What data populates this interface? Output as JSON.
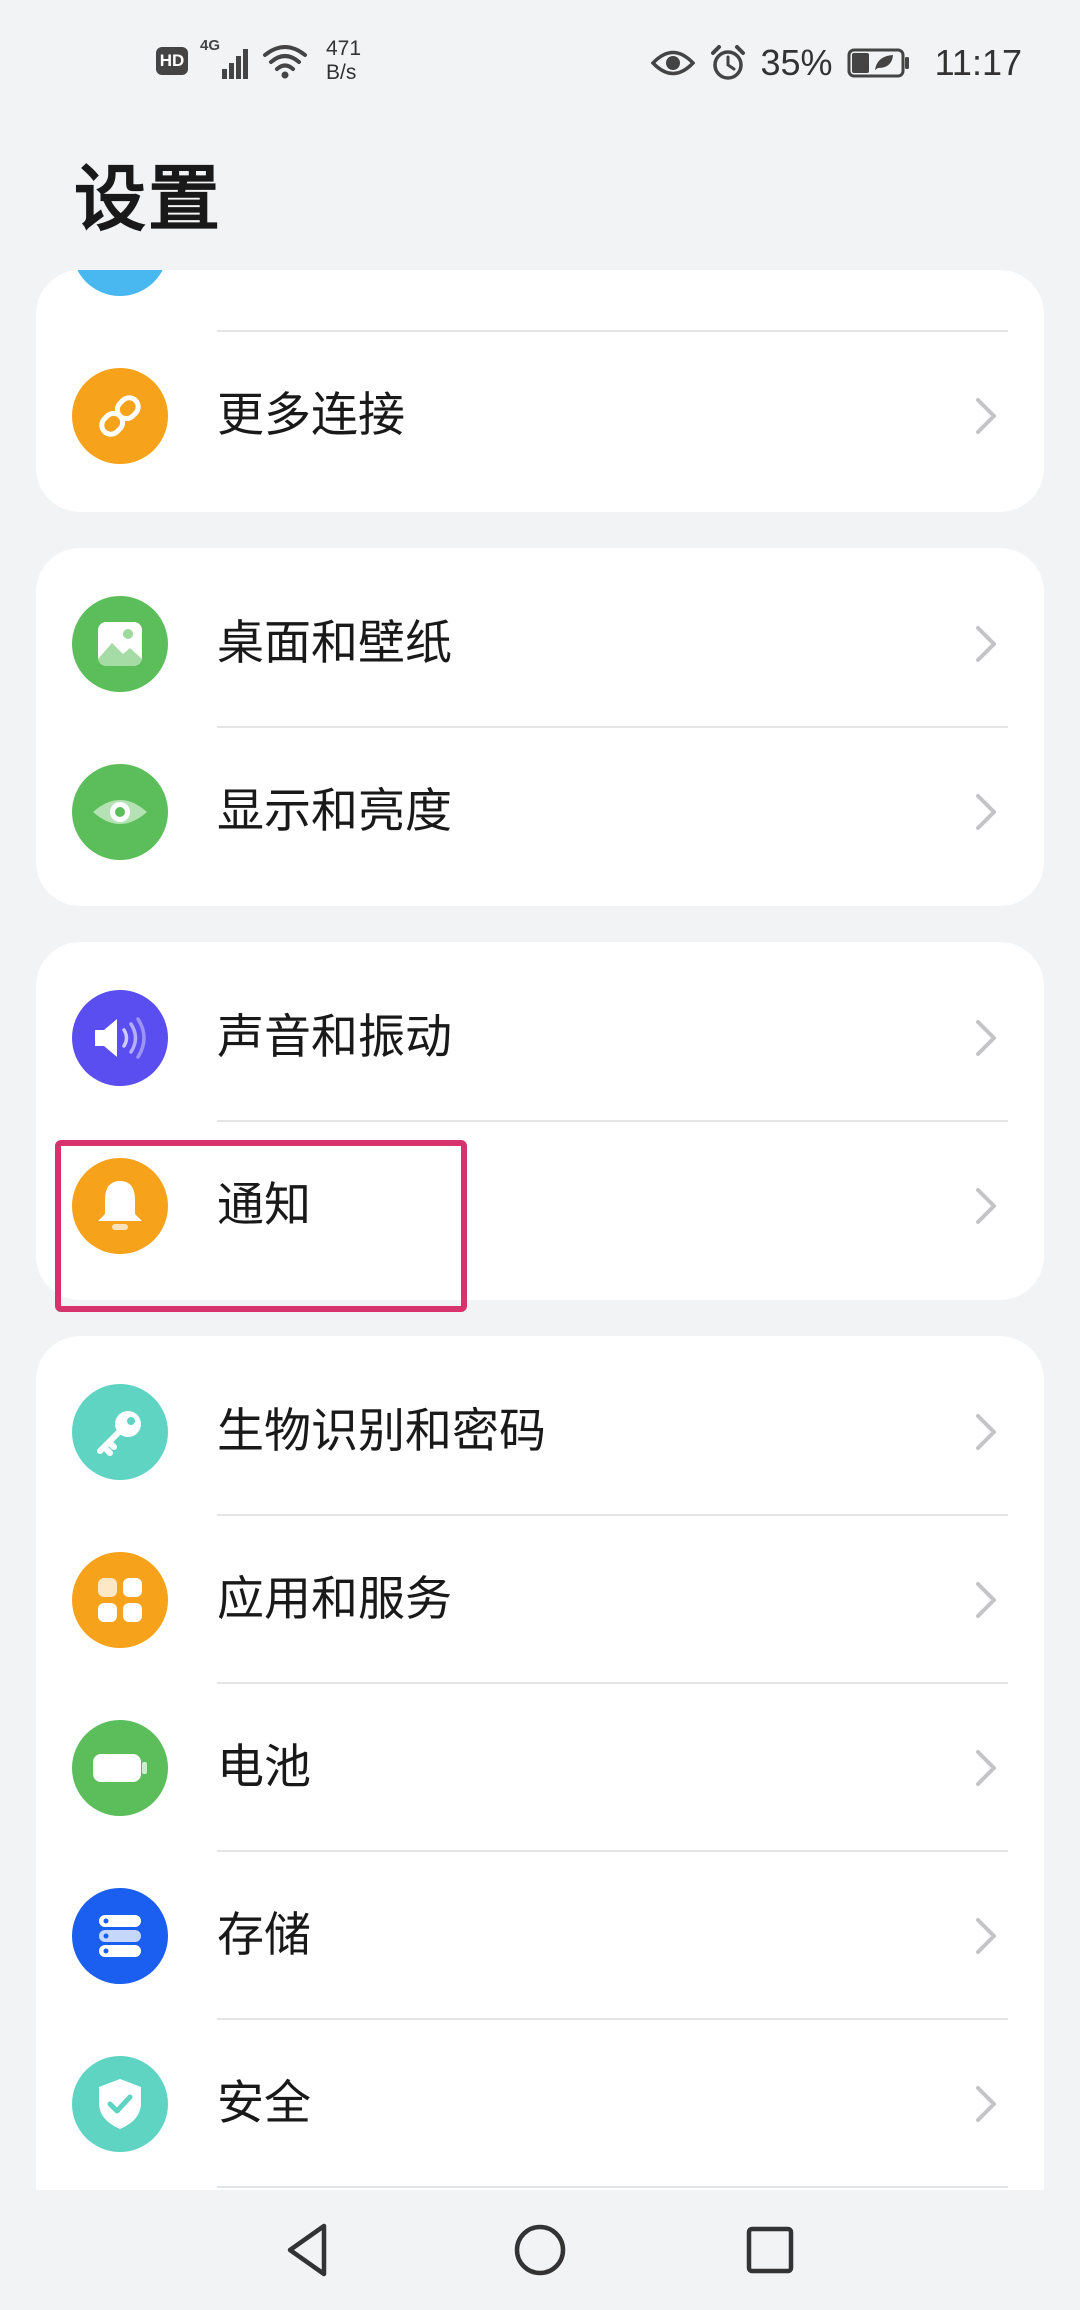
{
  "status_bar": {
    "hd": "HD",
    "network": "4G",
    "speed_value": "471",
    "speed_unit": "B/s",
    "battery": "35%",
    "time": "11:17"
  },
  "page": {
    "title": "设置"
  },
  "items": {
    "more_connections": "更多连接",
    "desktop_wallpaper": "桌面和壁纸",
    "display_brightness": "显示和亮度",
    "sound_vibration": "声音和振动",
    "notifications": "通知",
    "biometrics_password": "生物识别和密码",
    "apps_services": "应用和服务",
    "battery": "电池",
    "storage": "存储",
    "security": "安全"
  },
  "colors": {
    "orange": "#f7a21b",
    "green": "#5bbe5a",
    "purple": "#5b4ef0",
    "teal": "#5fd4c2",
    "blue": "#1b5ff0",
    "sky": "#4ab8f0",
    "highlight": "#d6336c"
  }
}
